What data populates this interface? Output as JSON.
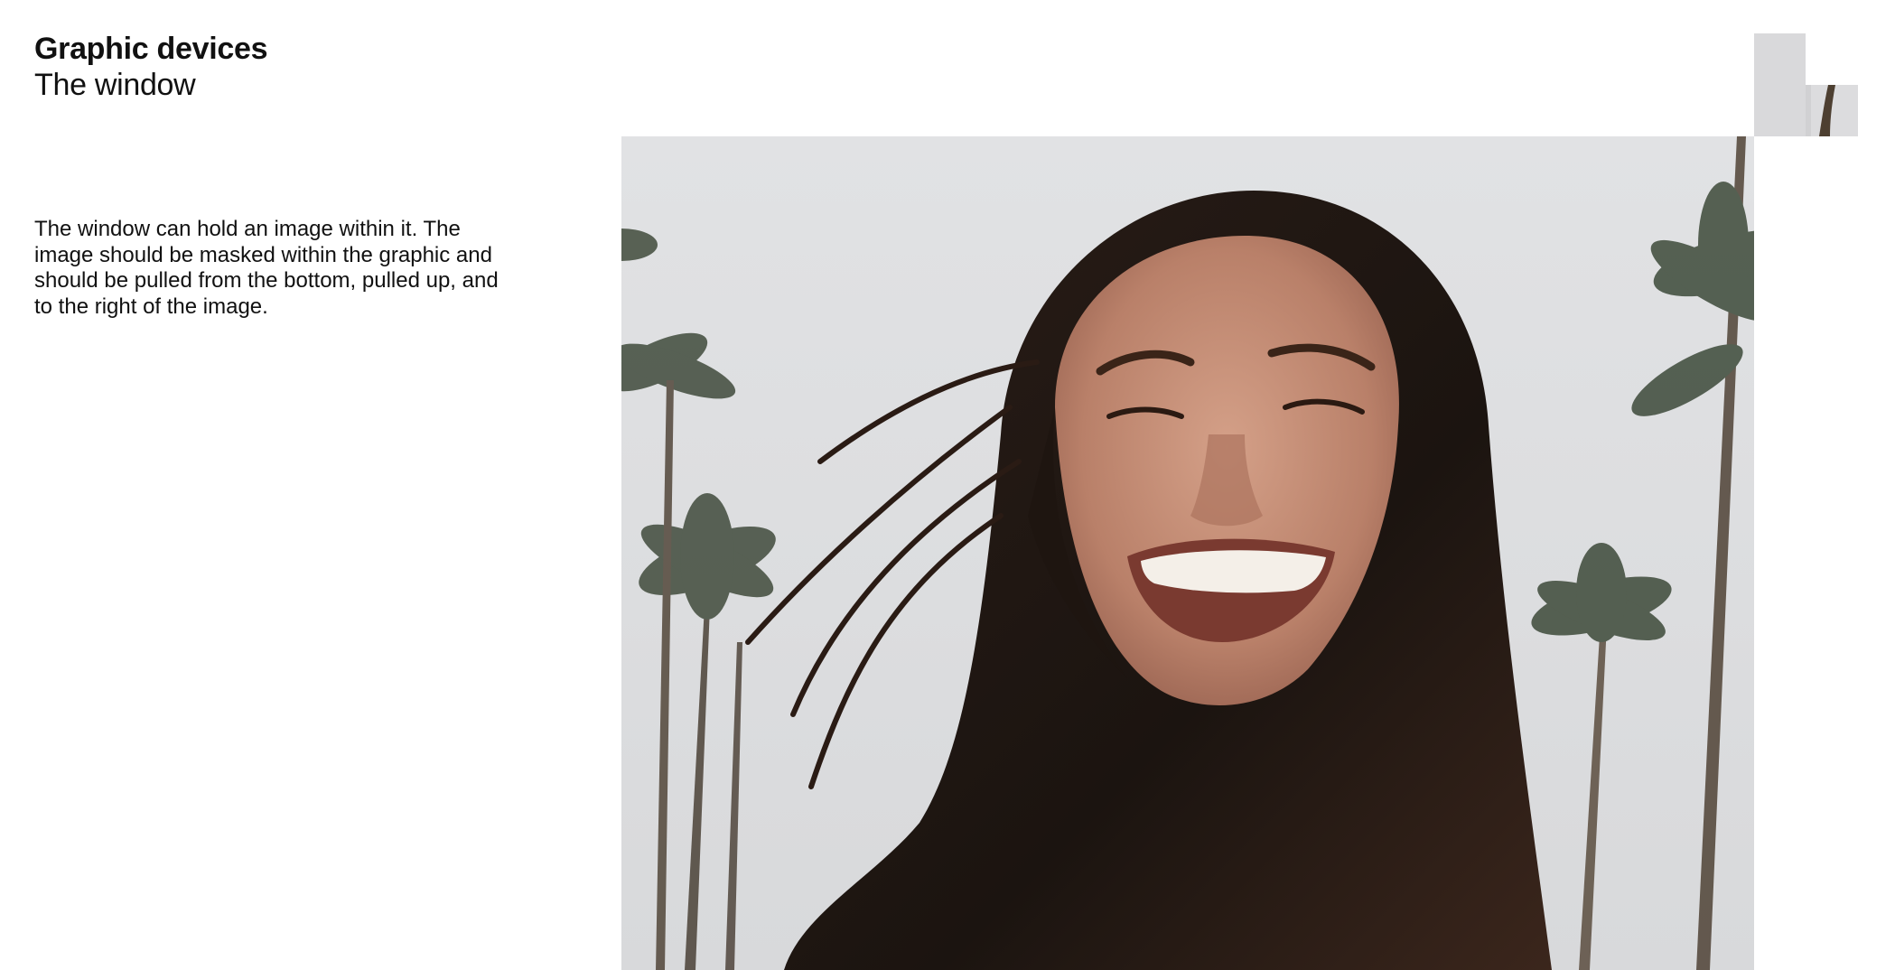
{
  "header": {
    "title": "Graphic devices",
    "subtitle": "The window"
  },
  "body": {
    "description": "The window can hold an image within it. The image should be masked within the graphic and should be pulled from the bottom, pulled up, and to the right of the image."
  },
  "window": {
    "image": "photo-woman-smiling-palm-trees",
    "sky_color": "#dedfe1",
    "hair_color": "#1d1612",
    "skin_color": "#c48e76"
  }
}
